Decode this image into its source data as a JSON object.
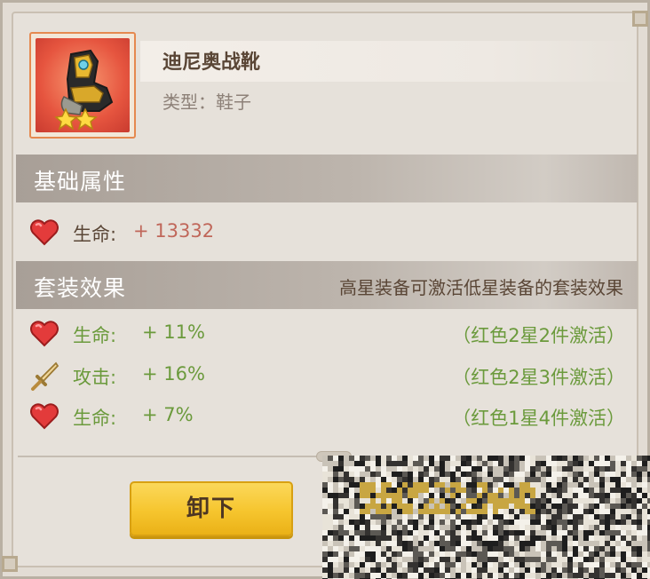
{
  "item": {
    "name": "迪尼奥战靴",
    "type": "类型：鞋子",
    "stars": 2
  },
  "base_section": {
    "title": "基础属性",
    "stats": [
      {
        "icon": "heart-icon",
        "label": "生命:",
        "value": "+ 13332"
      }
    ]
  },
  "set_section": {
    "title": "套装效果",
    "note": "高星装备可激活低星装备的套装效果",
    "effects": [
      {
        "icon": "heart-icon",
        "label": "生命:",
        "value": "+ 11%",
        "condition": "（红色2星2件激活）"
      },
      {
        "icon": "sword-icon",
        "label": "攻击:",
        "value": "+ 16%",
        "condition": "（红色2星3件激活）"
      },
      {
        "icon": "heart-icon",
        "label": "生命:",
        "value": "+ 7%",
        "condition": "（红色1星4件激活）"
      }
    ]
  },
  "actions": {
    "unequip_label": "卸下"
  },
  "colors": {
    "accent_button": "#f6c52e",
    "stat_green": "#6b9a3c",
    "value_red": "#c0675a",
    "text_brown": "#5a4636"
  }
}
